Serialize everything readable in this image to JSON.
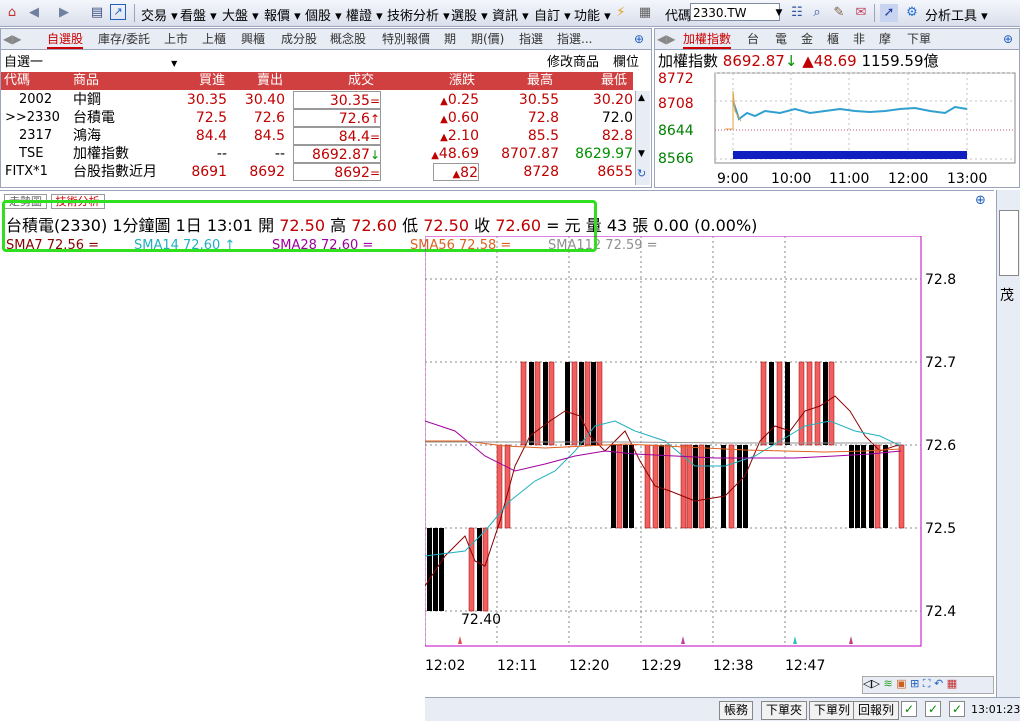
{
  "toolbar": {
    "menus": [
      "交易",
      "看盤",
      "大盤",
      "報價",
      "個股",
      "權證",
      "技術分析",
      "選股",
      "資訊",
      "自訂",
      "功能"
    ],
    "code_label": "代碼",
    "code_value": "2330.TW",
    "analysis_tools": "分析工具"
  },
  "watchlist": {
    "tabs": [
      "自選股",
      "庫存/委託",
      "上市",
      "上櫃",
      "興櫃",
      "成分股",
      "概念股",
      "特別報價",
      "期",
      "期(價)",
      "指選",
      "指選..."
    ],
    "group_name": "自選一",
    "edit_label": "修改商品",
    "columns_label": "欄位",
    "headers": [
      "代碼",
      "商品",
      "買進",
      "賣出",
      "成交",
      "漲跌",
      "最高",
      "最低"
    ],
    "rows": [
      {
        "code": "2002",
        "name": "中鋼",
        "bid": "30.35",
        "ask": "30.40",
        "last": "30.35",
        "sym": "=",
        "chg": "0.25",
        "high": "30.55",
        "low": "30.20"
      },
      {
        "code": ">>2330",
        "name": "台積電",
        "bid": "72.5",
        "ask": "72.6",
        "last": "72.6",
        "sym": "↑",
        "chg": "0.60",
        "high": "72.8",
        "low": "72.0"
      },
      {
        "code": "2317",
        "name": "鴻海",
        "bid": "84.4",
        "ask": "84.5",
        "last": "84.4",
        "sym": "=",
        "chg": "2.10",
        "high": "85.5",
        "low": "82.8"
      },
      {
        "code": "TSE",
        "name": "加權指數",
        "bid": "--",
        "ask": "--",
        "last": "8692.87",
        "sym": "↓",
        "chg": "48.69",
        "high": "8707.87",
        "low": "8629.97"
      },
      {
        "code": "FITX*1",
        "name": "台股指數近月",
        "bid": "8691",
        "ask": "8692",
        "last": "8692",
        "sym": "=",
        "chg": "82",
        "high": "8728",
        "low": "8655"
      }
    ]
  },
  "index_panel": {
    "tabs": [
      "加權指數",
      "台",
      "電",
      "金",
      "櫃",
      "非",
      "摩",
      "下單"
    ],
    "name": "加權指數",
    "value": "8692.87",
    "change": "48.69",
    "volume": "1159.59億",
    "y_labels": [
      "8772",
      "8708",
      "8644",
      "8566"
    ],
    "x_labels": [
      "9:00",
      "10:00",
      "11:00",
      "12:00",
      "13:00"
    ]
  },
  "chart_tabs": [
    "走勢圖",
    "技術分析"
  ],
  "quote_line": {
    "stock": "台積電(2330)",
    "period": "1分鐘圖",
    "date_time": "1日 13:01",
    "open_label": "開",
    "open": "72.50",
    "high_label": "高",
    "high": "72.60",
    "low_label": "低",
    "low": "72.50",
    "close_label": "收",
    "close": "72.60",
    "unit": "= 元",
    "vol_label": "量",
    "vol": "43 張",
    "change": "0.00 (0.00%)"
  },
  "sma_legend": [
    {
      "label": "SMA7 72.56 =",
      "color": "#8b0000"
    },
    {
      "label": "SMA14 72.60 ↑",
      "color": "#20b0c0"
    },
    {
      "label": "SMA28 72.60 =",
      "color": "#a000a0"
    },
    {
      "label": "SMA56 72.58 =",
      "color": "#e06020"
    },
    {
      "label": "SMA112 72.59 =",
      "color": "#909090"
    }
  ],
  "price_axis": [
    "72.8",
    "72.7",
    "72.6",
    "72.5",
    "72.4"
  ],
  "time_axis": [
    "12:02",
    "12:11",
    "12:20",
    "12:29",
    "12:38",
    "12:47"
  ],
  "low_marker": "72.40",
  "status_buttons": [
    "帳務",
    "下單夾",
    "下單列",
    "回報列"
  ],
  "clock": "13:01:23",
  "right_label": "茂"
}
